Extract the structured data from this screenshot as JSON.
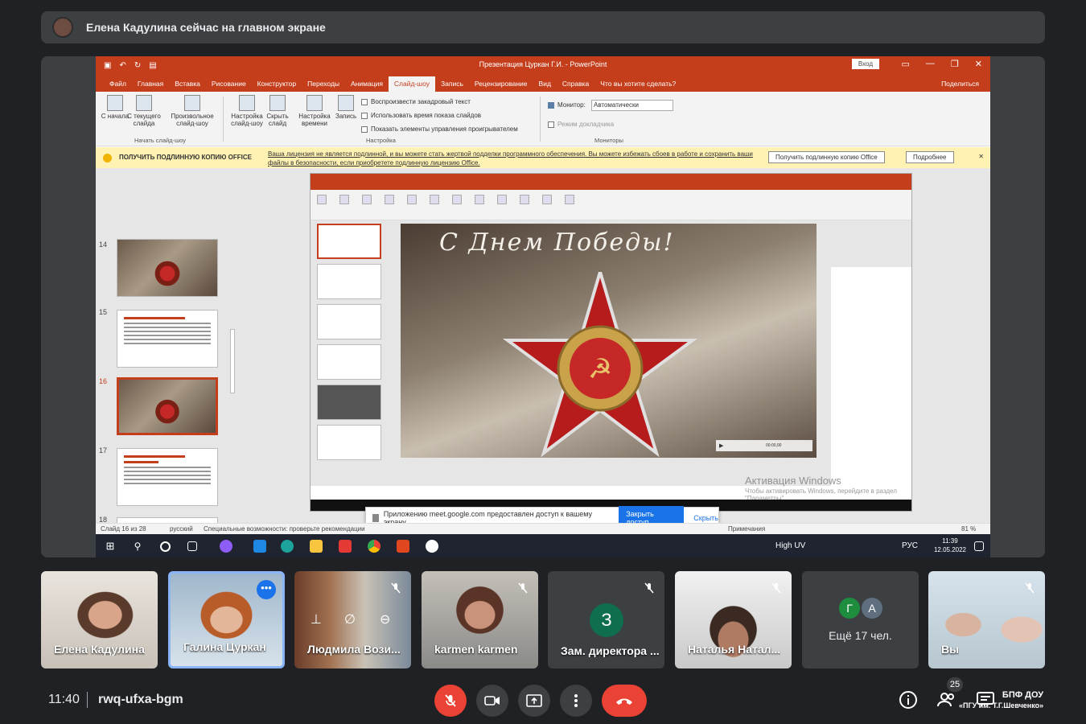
{
  "banner": {
    "text": "Елена Кадулина сейчас на главном экране"
  },
  "ppt": {
    "doc_title": "Презентация Цуркан Г.И. - PowerPoint",
    "signin": "Вход",
    "tabs": [
      "Файл",
      "Главная",
      "Вставка",
      "Рисование",
      "Конструктор",
      "Переходы",
      "Анимация",
      "Слайд-шоу",
      "Запись",
      "Рецензирование",
      "Вид",
      "Справка",
      "Что вы хотите сделать?"
    ],
    "active_tab": "Слайд-шоу",
    "share": "Поделиться",
    "ribbon": {
      "btn_start": "С начала",
      "btn_current": "С текущего слайда",
      "btn_custom": "Произвольное слайд-шоу",
      "group_start": "Начать слайд-шоу",
      "btn_setup": "Настройка слайд-шоу",
      "btn_hide": "Скрыть слайд",
      "btn_timing": "Настройка времени",
      "btn_record": "Запись",
      "chk1": "Воспроизвести закадровый текст",
      "chk2": "Использовать время показа слайдов",
      "chk3": "Показать элементы управления проигрывателем",
      "group_setup": "Настройка",
      "monitor_label": "Монитор:",
      "monitor_value": "Автоматически",
      "presenter": "Режим докладчика",
      "group_monitors": "Мониторы"
    },
    "warning": {
      "heading": "ПОЛУЧИТЬ ПОДЛИННУЮ КОПИЮ OFFICE",
      "message": "Ваша лицензия не является подлинной, и вы можете стать жертвой подделки программного обеспечения. Вы можете избежать сбоев в работе и сохранить ваши файлы в безопасности, если приобретете подлинную лицензию Office.",
      "btn_get": "Получить подлинную копию Office",
      "btn_more": "Подробнее"
    },
    "slide_numbers": [
      "14",
      "15",
      "16",
      "17",
      "18"
    ],
    "inner": {
      "greeting": "С Днем Победы!",
      "activation": "Активация Windows",
      "activation_sub": "Чтобы активировать Windows, перейдите в раздел \"Параметры\".",
      "player_time": "00:00,00"
    },
    "toast": {
      "message": "Приложению meet.google.com предоставлен доступ к вашему экрану.",
      "stop": "Закрыть доступ",
      "hide": "Скрыть"
    },
    "status": {
      "slide": "Слайд 16 из 28",
      "lang": "русский",
      "accessibility": "Специальные возможности: проверьте рекомендации",
      "notes": "Примечания",
      "zoom": "81 %"
    },
    "taskbar": {
      "weather": "High UV",
      "lang": "РУС",
      "time": "11:39",
      "date": "12.05.2022"
    }
  },
  "tiles": [
    {
      "name": "Елена Кадулина"
    },
    {
      "name": "Галина Цуркан"
    },
    {
      "name": "Людмила Вози..."
    },
    {
      "name": "karmen karmen"
    },
    {
      "name": "Зам. директора ...",
      "letter": "З"
    },
    {
      "name": "Наталья Натал..."
    },
    {
      "more_text": "Ещё 17 чел.",
      "a1": "Г",
      "a2": "А"
    },
    {
      "name": "Вы"
    }
  ],
  "bottom": {
    "time": "11:40",
    "code": "rwq-ufxa-bgm",
    "participants": "25",
    "watermark_1": "БПФ ДОУ",
    "watermark_2": "«ПГУ им. Т.Г.Шевченко»"
  }
}
